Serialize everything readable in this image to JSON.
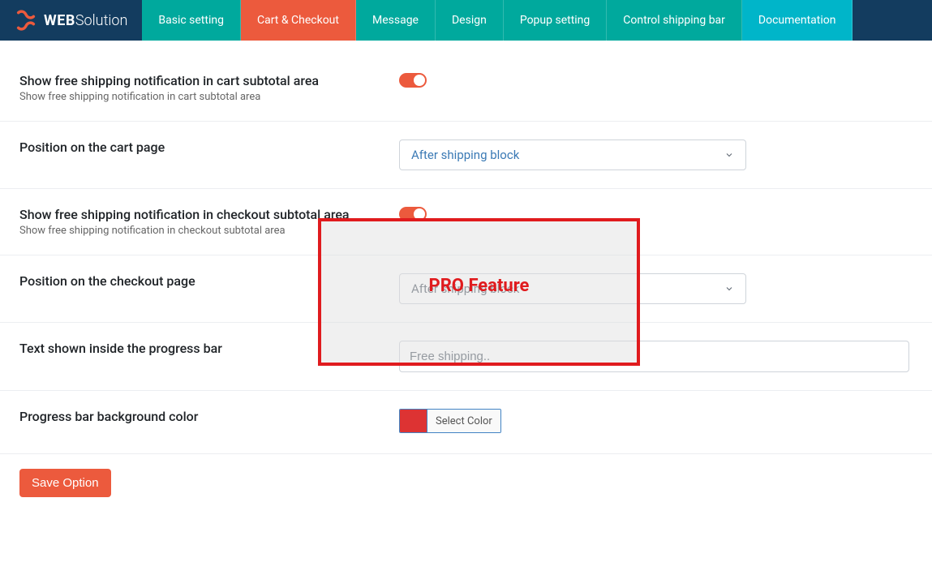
{
  "brand": {
    "part1": "WEB",
    "part2": "Solution"
  },
  "nav": {
    "basic": "Basic setting",
    "cart": "Cart & Checkout",
    "message": "Message",
    "design": "Design",
    "popup": "Popup setting",
    "control": "Control shipping bar",
    "doc": "Documentation"
  },
  "rows": {
    "r1": {
      "title": "Show free shipping notification in cart subtotal area",
      "desc": "Show free shipping notification in cart subtotal area"
    },
    "r2": {
      "title": "Position on the cart page",
      "select": "After shipping block"
    },
    "r3": {
      "title": "Show free shipping notification in checkout subtotal area",
      "desc": "Show free shipping notification in checkout subtotal area"
    },
    "r4": {
      "title": "Position on the checkout page",
      "select": "After shipping block"
    },
    "r5": {
      "title": "Text shown inside the progress bar",
      "value": "Free shipping.."
    },
    "r6": {
      "title": "Progress bar background color",
      "picker_label": "Select Color",
      "color": "#dd3333"
    }
  },
  "pro_label": "PRO Feature",
  "save_label": "Save Option"
}
